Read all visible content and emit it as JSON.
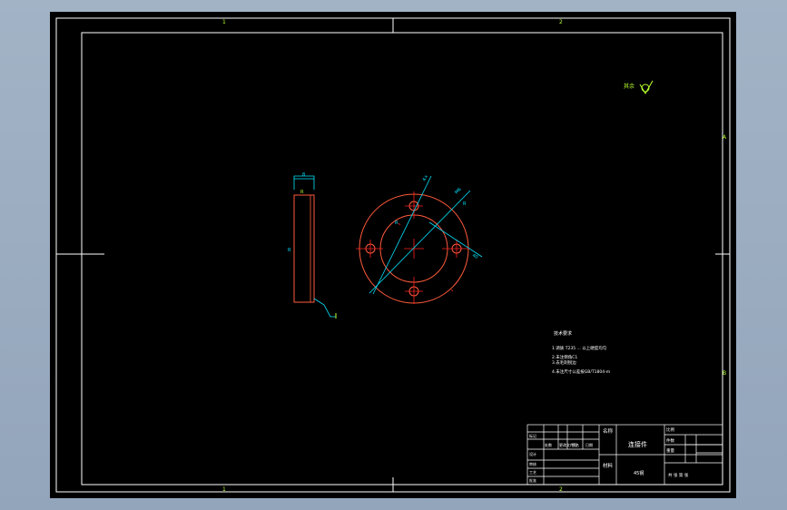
{
  "sheet": {
    "zone_marks_top": [
      "1",
      "2"
    ],
    "zone_marks_bottom": [
      "1",
      "2"
    ],
    "zone_marks_right": [
      "A",
      "B"
    ]
  },
  "roughness": {
    "label": "其余",
    "value": ""
  },
  "side_view": {
    "dims": [
      "8",
      "R",
      "R"
    ]
  },
  "front_view": {
    "dims": [
      "4×",
      "M6",
      "R",
      "40",
      "R"
    ]
  },
  "notes": {
    "title": "技术要求",
    "lines": [
      "1.调质 T235 ... 以上硬度均匀",
      "2.未注倒角C1",
      "3.去毛刺锐边",
      "4.未注尺寸公差按GB/T1804-m"
    ]
  },
  "title_block": {
    "part_name": "连接件",
    "name_label": "名称",
    "material_label": "材料",
    "material_value": "45钢",
    "drawing_no": "",
    "scale_label": "比例",
    "qty_label": "件数",
    "weight_label": "重量",
    "sheet_label": "共 张 第 张",
    "row_labels": [
      "设计",
      "审核",
      "工艺",
      "批准"
    ],
    "header_labels": [
      "标记",
      "处数",
      "更改文件号",
      "签名",
      "日期"
    ],
    "footer_text": "共 张 第 张"
  },
  "colors": {
    "background": "#000000",
    "frame": "#ffffff",
    "part_outline": "#ff5a3c",
    "dimension": "#00e5ff",
    "text": "#ffffff",
    "annotation": "#b8ff2e",
    "centerline": "#ff2020"
  }
}
